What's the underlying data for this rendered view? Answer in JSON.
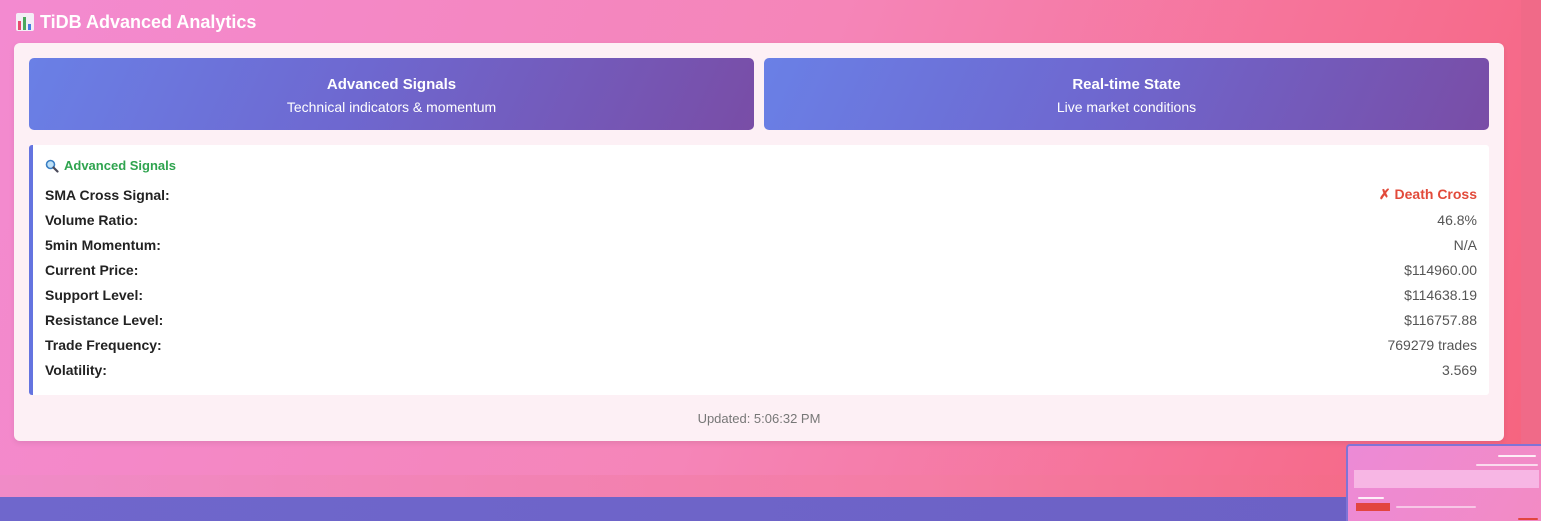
{
  "header": {
    "title": "TiDB Advanced Analytics",
    "icon": "bar-chart-icon"
  },
  "tabs": [
    {
      "title": "Advanced Signals",
      "subtitle": "Technical indicators & momentum"
    },
    {
      "title": "Real-time State",
      "subtitle": "Live market conditions"
    }
  ],
  "signals": {
    "heading": "Advanced Signals",
    "heading_icon": "magnifier-icon",
    "rows": [
      {
        "label": "SMA Cross Signal:",
        "value": "✗ Death Cross"
      },
      {
        "label": "Volume Ratio:",
        "value": "46.8%"
      },
      {
        "label": "5min Momentum:",
        "value": "N/A"
      },
      {
        "label": "Current Price:",
        "value": "$114960.00"
      },
      {
        "label": "Support Level:",
        "value": "$114638.19"
      },
      {
        "label": "Resistance Level:",
        "value": "$116757.88"
      },
      {
        "label": "Trade Frequency:",
        "value": "769279 trades"
      },
      {
        "label": "Volatility:",
        "value": "3.569"
      }
    ]
  },
  "footer": {
    "updated": "Updated: 5:06:32 PM"
  },
  "colors": {
    "accent": "#6474e0",
    "alert": "#e24a3a",
    "heading_green": "#2fa44f"
  }
}
